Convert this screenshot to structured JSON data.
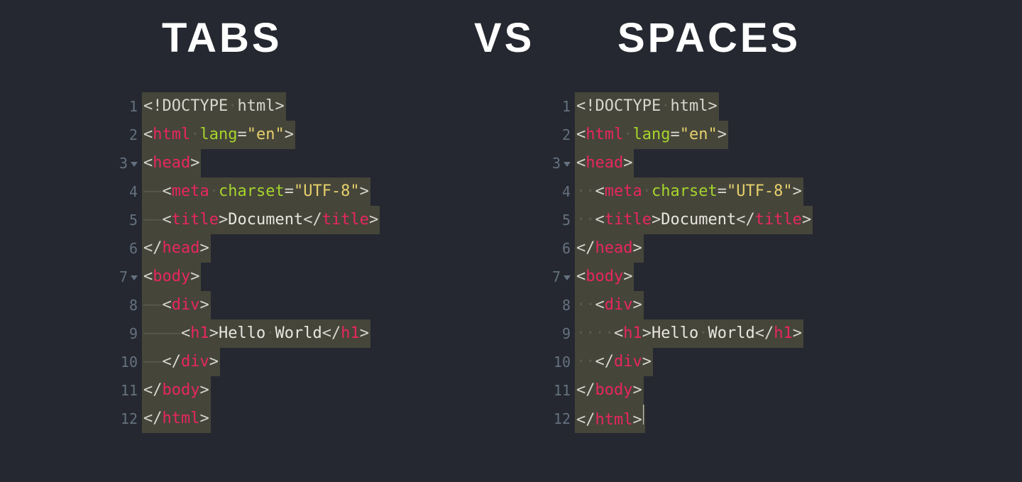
{
  "headings": {
    "left": "TABS",
    "center": "VS",
    "right": "SPACES"
  },
  "colors": {
    "bg": "#252830",
    "codebg": "#45453a",
    "gutter": "#65717f",
    "bracket": "#d7d7d0",
    "tag": "#e8265e",
    "attr": "#a6d42c",
    "string": "#e6d06c",
    "text": "#e8e6df",
    "whitespace": "#5a5a4e"
  },
  "numbers": [
    "1",
    "2",
    "3",
    "4",
    "5",
    "6",
    "7",
    "8",
    "9",
    "10",
    "11",
    "12"
  ],
  "fold_lines": [
    3,
    7
  ],
  "tokens": {
    "doctype": "!DOCTYPE",
    "html": "html",
    "lang": "lang",
    "en": "\"en\"",
    "head": "head",
    "meta": "meta",
    "charset": "charset",
    "utf8": "\"UTF-8\"",
    "title": "title",
    "document": "Document",
    "body": "body",
    "div": "div",
    "h1": "h1",
    "hello": "Hello",
    "world": "World",
    "lt": "<",
    "gt": ">",
    "lts": "</",
    "eq": "=",
    "sp": " ",
    "dot_sp": "·",
    "tab_mark": "――",
    "space_mark": "··"
  }
}
